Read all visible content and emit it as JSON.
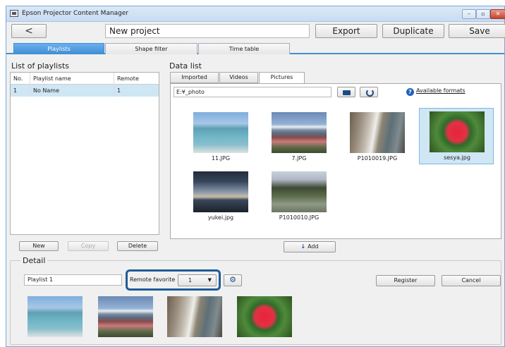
{
  "window": {
    "title": "Epson Projector Content Manager",
    "controls": {
      "minimize": "–",
      "maximize": "▫",
      "close": "✕"
    }
  },
  "toolbar": {
    "back_label": "<",
    "project_name": "New project",
    "export_label": "Export",
    "duplicate_label": "Duplicate",
    "save_label": "Save"
  },
  "tabs": [
    {
      "label": "Playlists",
      "active": true
    },
    {
      "label": "Shape filter",
      "active": false
    },
    {
      "label": "Time table",
      "active": false
    }
  ],
  "playlists": {
    "title": "List of playlists",
    "columns": [
      "No.",
      "Playlist name",
      "Remote"
    ],
    "rows": [
      {
        "no": "1",
        "name": "No Name",
        "remote": "1"
      }
    ],
    "buttons": {
      "new": "New",
      "copy": "Copy",
      "delete": "Delete"
    }
  },
  "data_list": {
    "title": "Data list",
    "tabs": [
      "Imported",
      "Videos",
      "Pictures"
    ],
    "active_tab": "Pictures",
    "path": "E:¥_photo",
    "formats_link": "Available formats",
    "items": [
      {
        "filename": "11.JPG",
        "image": "sea"
      },
      {
        "filename": "7.JPG",
        "image": "mount-fuji"
      },
      {
        "filename": "P1010019.JPG",
        "image": "hot-spring"
      },
      {
        "filename": "sesya.jpg",
        "image": "red-flower",
        "selected": true
      },
      {
        "filename": "yukei.jpg",
        "image": "sunset"
      },
      {
        "filename": "P1010010.JPG",
        "image": "trees"
      }
    ],
    "add_label": "Add"
  },
  "detail": {
    "title": "Detail",
    "playlist_name": "Playlist 1",
    "remote_favorite_label": "Remote favorite",
    "remote_favorite_value": "1",
    "register_label": "Register",
    "cancel_label": "Cancel",
    "images": [
      "sea",
      "mount-fuji",
      "hot-spring",
      "red-flower"
    ]
  },
  "colors": {
    "accent": "#3f8fd2",
    "selection": "#cfe6f4",
    "highlight_border": "#1f5d9a"
  }
}
